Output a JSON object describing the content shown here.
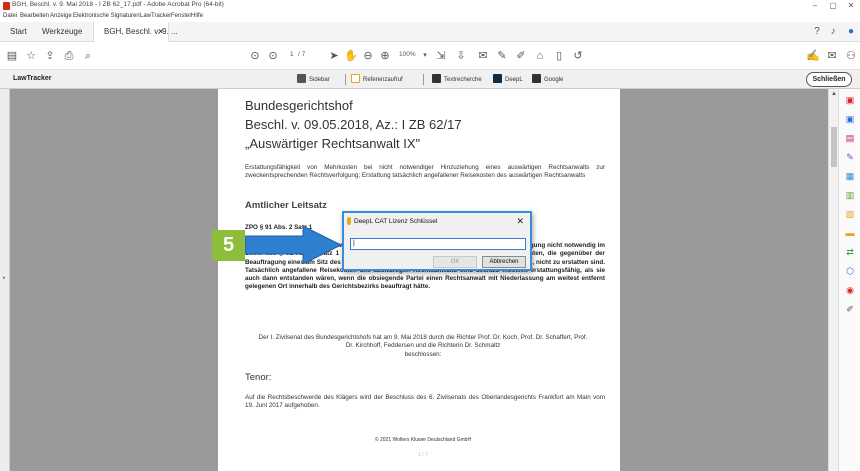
{
  "window": {
    "title": "BGH, Beschl. v. 9. Mai 2018 - I ZB 62_17.pdf - Adobe Acrobat Pro (64-bit)",
    "controls": [
      "–",
      "▢",
      "✕"
    ]
  },
  "menu": [
    "Datei",
    "Bearbeiten",
    "Anzeige",
    "Elektronische Signaturen",
    "LawTracker",
    "Fenster",
    "Hilfe"
  ],
  "tabs": {
    "start": "Start",
    "tools": "Werkzeuge",
    "doc": "BGH, Beschl. v. 9. ...",
    "close": "×"
  },
  "toolbar": {
    "page_current": "1",
    "page_total": "/ 7",
    "zoom": "100%"
  },
  "lawtracker": {
    "title": "LawTracker",
    "buttons": [
      "Sidebar",
      "Referenzaufruf",
      "Textrecherche",
      "DeepL",
      "Google"
    ],
    "close_label": "Schließen"
  },
  "document": {
    "court": "Bundesgerichtshof",
    "decision": "Beschl. v. 09.05.2018, Az.: I ZB 62/17",
    "subtitle": "„Auswärtiger Rechtsanwalt IX\"",
    "summary": "Erstattungsfähigkeit von Mehrkosten bei nicht notwendiger Hinzuziehung eines auswärtigen Rechtsanwalts zur zweckentsprechenden Rechtsverfolgung; Erstattung tatsächlich angefallener Reisekosten des auswärtigen Rechtsanwalts",
    "leitsatz_heading": "Amtlicher Leitsatz",
    "zpo_ref": "ZPO § 91 Abs. 2 Satz 1",
    "leitsatz_body": "Ist die Hinzuziehung eines auswärtigen Rechtsanwalts zur zweckentsprechenden Rechtsverfolgung nicht notwendig im Sinne des § 91 Abs. 2 Satz 1 ZPO, führt dies nicht ohne weiteres dazu, dass die Mehrkosten, die gegenüber der Beauftragung eines am Sitz des Gerichts ansässigen Prozessbevollmächtigten entstanden sind, nicht zu erstatten sind. Tatsächlich angefallene Reisekosten des auswärtigen Rechtsanwalts sind deshalb insoweit erstattungsfähig, als sie auch dann entstanden wären, wenn die obsiegende Partei einen Rechtsanwalt mit Niederlassung am weitest entfernt gelegenen Ort innerhalb des Gerichtsbezirks beauftragt hätte.",
    "senate": "Der I. Zivilsenat des Bundesgerichtshofs hat am 9. Mai 2018 durch die Richter Prof. Dr. Koch, Prof. Dr. Schaffert, Prof. Dr. Kirchhoff, Feddersen und die Richterin Dr. Schmaltz",
    "beschlossen": "beschlossen:",
    "tenor_heading": "Tenor:",
    "tenor_body": "Auf die Rechtsbeschwerde des Klägers wird der Beschluss des 6. Zivilsenats des Oberlandesgerichts Frankfurt am Main vom 19. Juni 2017 aufgehoben.",
    "footer": "© 2021 Wolters Kluwer Deutschland GmbH",
    "page_footer": "1 / 7"
  },
  "dialog": {
    "title": "DeepL CAT Lizenz Schlüssel",
    "close": "✕",
    "input_value": "",
    "ok_label": "OK",
    "cancel_label": "Abbrechen"
  },
  "step": {
    "number": "5"
  },
  "colors": {
    "accent": "#3a8ed8",
    "step_badge": "#8dbd3b",
    "arrow": "#2f7fd0",
    "acrobat_red": "#d9261c"
  }
}
